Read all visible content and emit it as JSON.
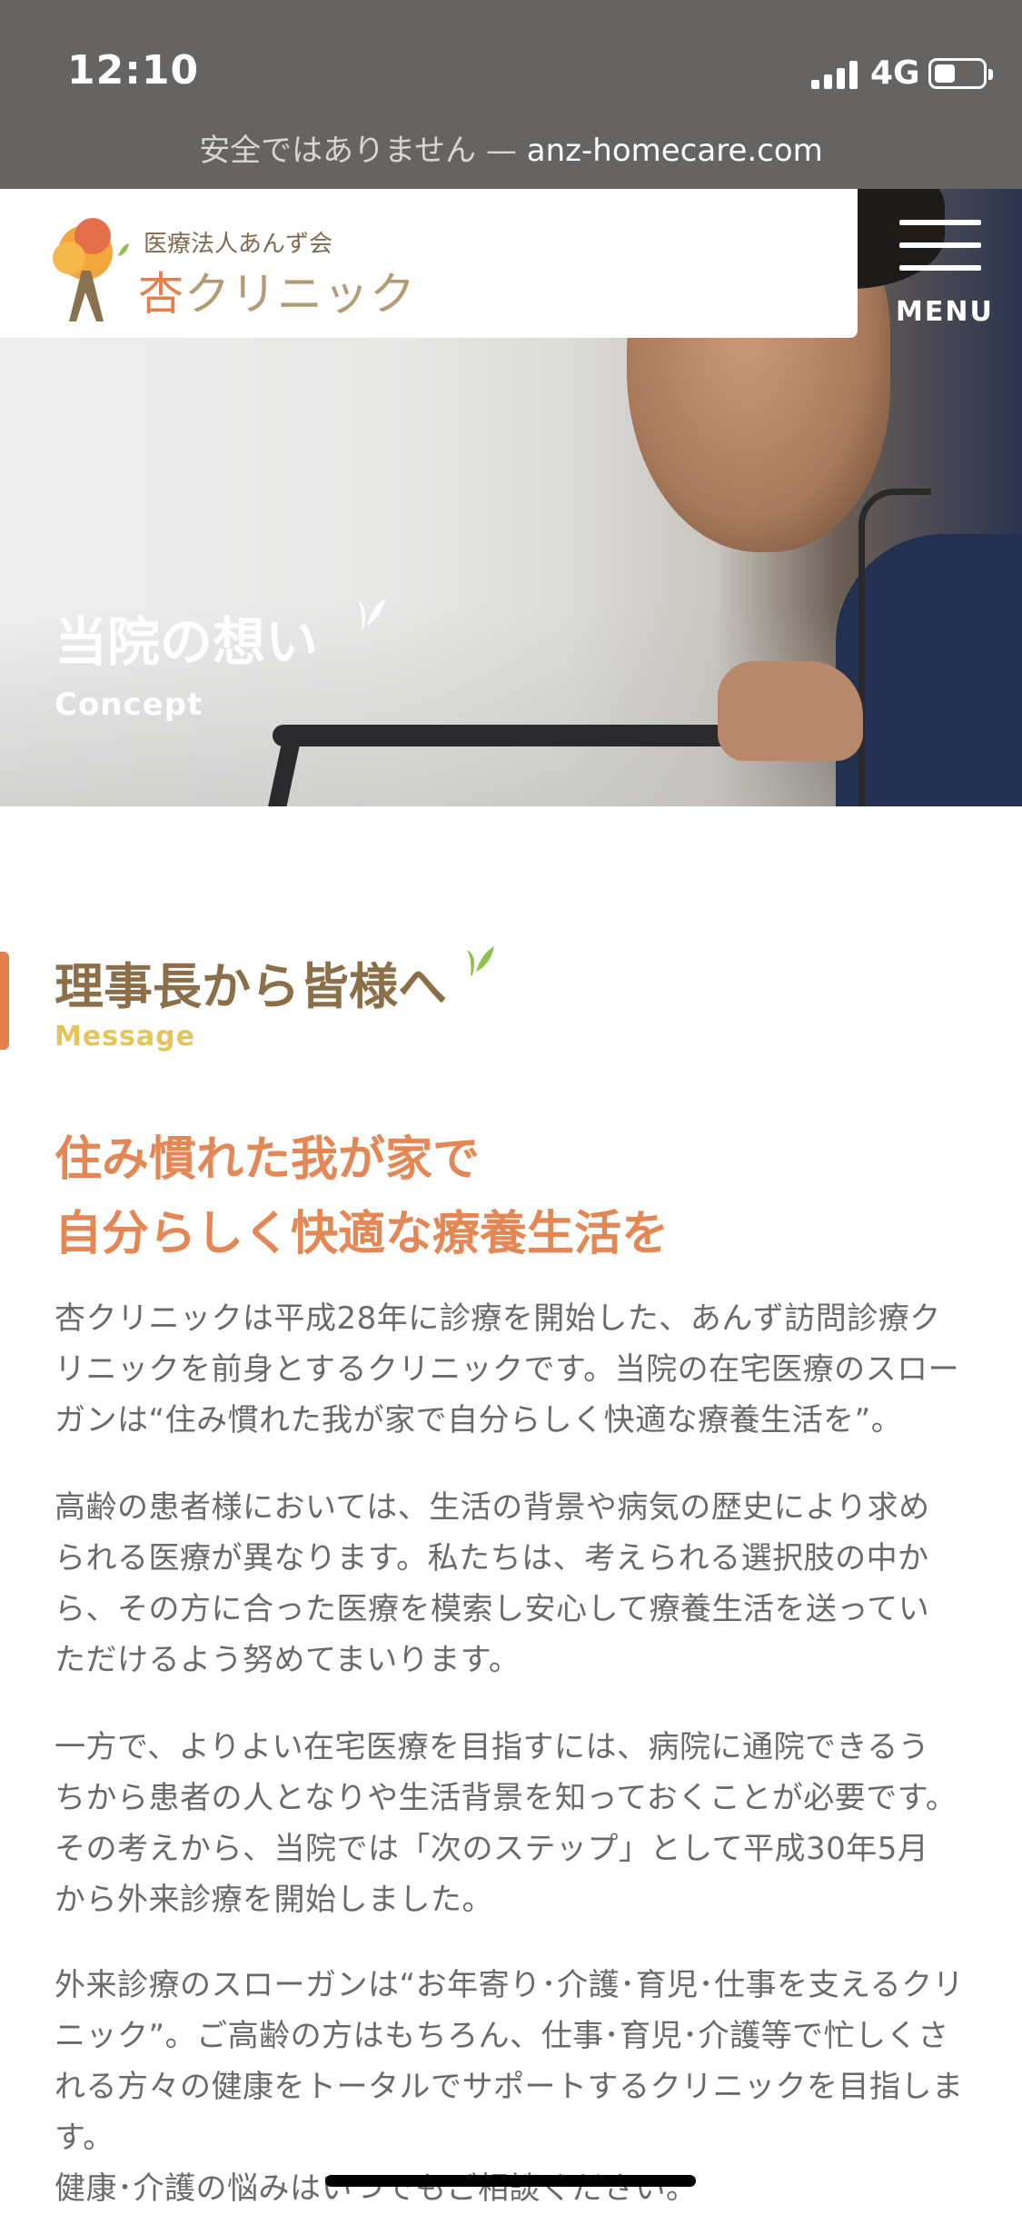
{
  "status_bar": {
    "time": "12:10",
    "network": "4G",
    "url_warning": "安全ではありません — ",
    "url_host": "anz-homecare.com"
  },
  "header": {
    "corp_name": "医療法人あんず会",
    "clinic_name_kanji": "杏",
    "clinic_name_kana": "クリニック",
    "menu_label": "MENU"
  },
  "hero": {
    "title": "当院の想い",
    "subtitle": "Concept"
  },
  "section": {
    "title": "理事長から皆様へ",
    "subtitle": "Message",
    "slogan_line1": "住み慣れた我が家で",
    "slogan_line2": "自分らしく快適な療養生活を",
    "paragraphs": [
      [
        "杏クリニックは平成28年に診療を開始した、あんず訪問診療ク",
        "リニックを前身とするクリニックです。当院の在宅医療のスロー",
        "ガンは“住み慣れた我が家で自分らしく快適な療養生活を”。"
      ],
      [
        "高齢の患者様においては、生活の背景や病気の歴史により求め",
        "られる医療が異なります。私たちは、考えられる選択肢の中か",
        "ら、その方に合った医療を模索し安心して療養生活を送ってい",
        "ただけるよう努めてまいります。"
      ],
      [
        "一方で、よりよい在宅医療を目指すには、病院に通院できるう",
        "ちから患者の人となりや生活背景を知っておくことが必要です。",
        "その考えから、当院では「次のステップ」として平成30年5月",
        "から外来診療を開始しました。"
      ],
      [
        "外来診療のスローガンは“お年寄り･介護･育児･仕事を支えるクリ",
        "ニック”。ご高齢の方はもちろん、仕事･育児･介護等で忙しくさ",
        "れる方々の健康をトータルでサポートするクリニックを目指しま",
        "す。",
        "健康･介護の悩みはいつでもご相談ください。"
      ]
    ]
  },
  "colors": {
    "accent_orange": "#e47f4c",
    "title_brown": "#8c6f48",
    "subtitle_yellow": "#e5c55a",
    "status_gray": "#666462"
  }
}
